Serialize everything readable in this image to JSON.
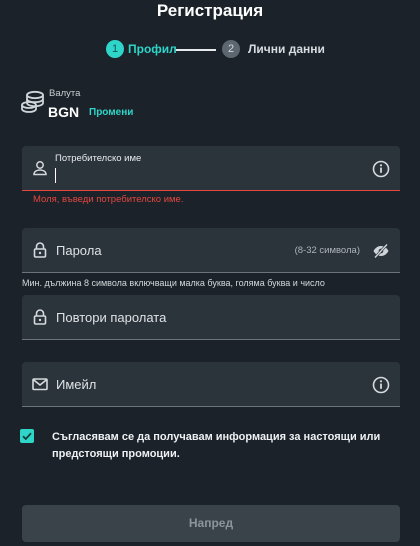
{
  "page": {
    "title": "Регистрация"
  },
  "stepper": {
    "steps": [
      {
        "number": "1",
        "label": "Профил",
        "active": true
      },
      {
        "number": "2",
        "label": "Лични данни",
        "active": false
      }
    ]
  },
  "currency": {
    "label": "Валута",
    "value": "BGN",
    "change_label": "Промени"
  },
  "form": {
    "username": {
      "label": "Потребителско име",
      "value": "",
      "error": "Моля, въведи потребителско име."
    },
    "password": {
      "placeholder": "Парола",
      "length_hint": "(8-32 символа)",
      "requirements": "Мин. дължина 8 символа включващи малка буква, голяма буква и число"
    },
    "repeat_password": {
      "placeholder": "Повтори паролата"
    },
    "email": {
      "placeholder": "Имейл"
    },
    "consent": {
      "checked": true,
      "text": "Съгласявам се да получавам информация за настоящи или предстоящи промоции."
    },
    "submit_label": "Напред"
  },
  "colors": {
    "background": "#1b2229",
    "field": "#2b333b",
    "accent": "#2fd5c9",
    "error": "#e3473f",
    "button_disabled": "#3a424a"
  }
}
